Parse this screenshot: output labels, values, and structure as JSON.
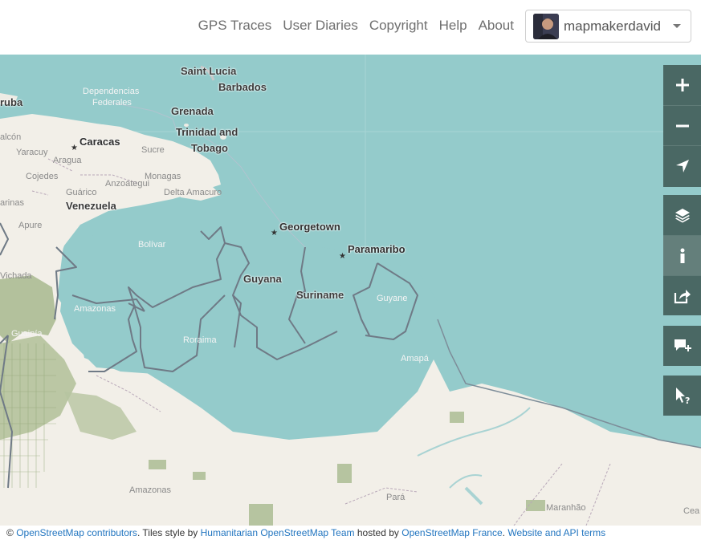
{
  "header": {
    "nav": [
      {
        "label": "GPS Traces"
      },
      {
        "label": "User Diaries"
      },
      {
        "label": "Copyright"
      },
      {
        "label": "Help"
      },
      {
        "label": "About"
      }
    ],
    "user": {
      "name": "mapmakerdavid"
    }
  },
  "map": {
    "cities": [
      {
        "name": "Caracas"
      },
      {
        "name": "Georgetown"
      },
      {
        "name": "Paramaribo"
      }
    ],
    "countries": [
      {
        "name": "Saint Lucia"
      },
      {
        "name": "Barbados"
      },
      {
        "name": "Grenada"
      },
      {
        "name": "Trinidad and"
      },
      {
        "name": "Tobago"
      },
      {
        "name": "Venezuela"
      },
      {
        "name": "Guyana"
      },
      {
        "name": "Suriname"
      },
      {
        "name": "ruba"
      }
    ],
    "regions": [
      {
        "name": "Dependencias"
      },
      {
        "name": "Federales"
      },
      {
        "name": "Sucre"
      },
      {
        "name": "Monagas"
      },
      {
        "name": "Anzoátegui"
      },
      {
        "name": "Delta Amacuro"
      },
      {
        "name": "Guárico"
      },
      {
        "name": "Cojedes"
      },
      {
        "name": "Yaracuy"
      },
      {
        "name": "Aragua"
      },
      {
        "name": "alcón"
      },
      {
        "name": "arinas"
      },
      {
        "name": "Apure"
      },
      {
        "name": "Bolívar"
      },
      {
        "name": "Amazonas"
      },
      {
        "name": "Vichada"
      },
      {
        "name": "Guainía"
      },
      {
        "name": "Roraima"
      },
      {
        "name": "Guyane"
      },
      {
        "name": "Amapá"
      },
      {
        "name": "Amazonas"
      },
      {
        "name": "Pará"
      },
      {
        "name": "Maranhão"
      },
      {
        "name": "Cea"
      }
    ]
  },
  "controls": {
    "zoom_in": "plus-icon",
    "zoom_out": "minus-icon",
    "locate": "location-arrow-icon",
    "layers": "layers-icon",
    "info": "info-icon",
    "share": "share-icon",
    "note": "add-note-icon",
    "query": "query-features-icon"
  },
  "attribution": {
    "prefix": "© ",
    "osm": "OpenStreetMap contributors",
    "t1": ". Tiles style by ",
    "hot": "Humanitarian OpenStreetMap Team",
    "t2": " hosted by ",
    "osmfr": "OpenStreetMap France",
    "t3": ". ",
    "terms": "Website and API terms"
  },
  "colors": {
    "ocean": "#94cbcb",
    "land": "#f2efe8",
    "forest": "#a8b98e",
    "controls": "#4a6864",
    "link": "#2376c0"
  }
}
